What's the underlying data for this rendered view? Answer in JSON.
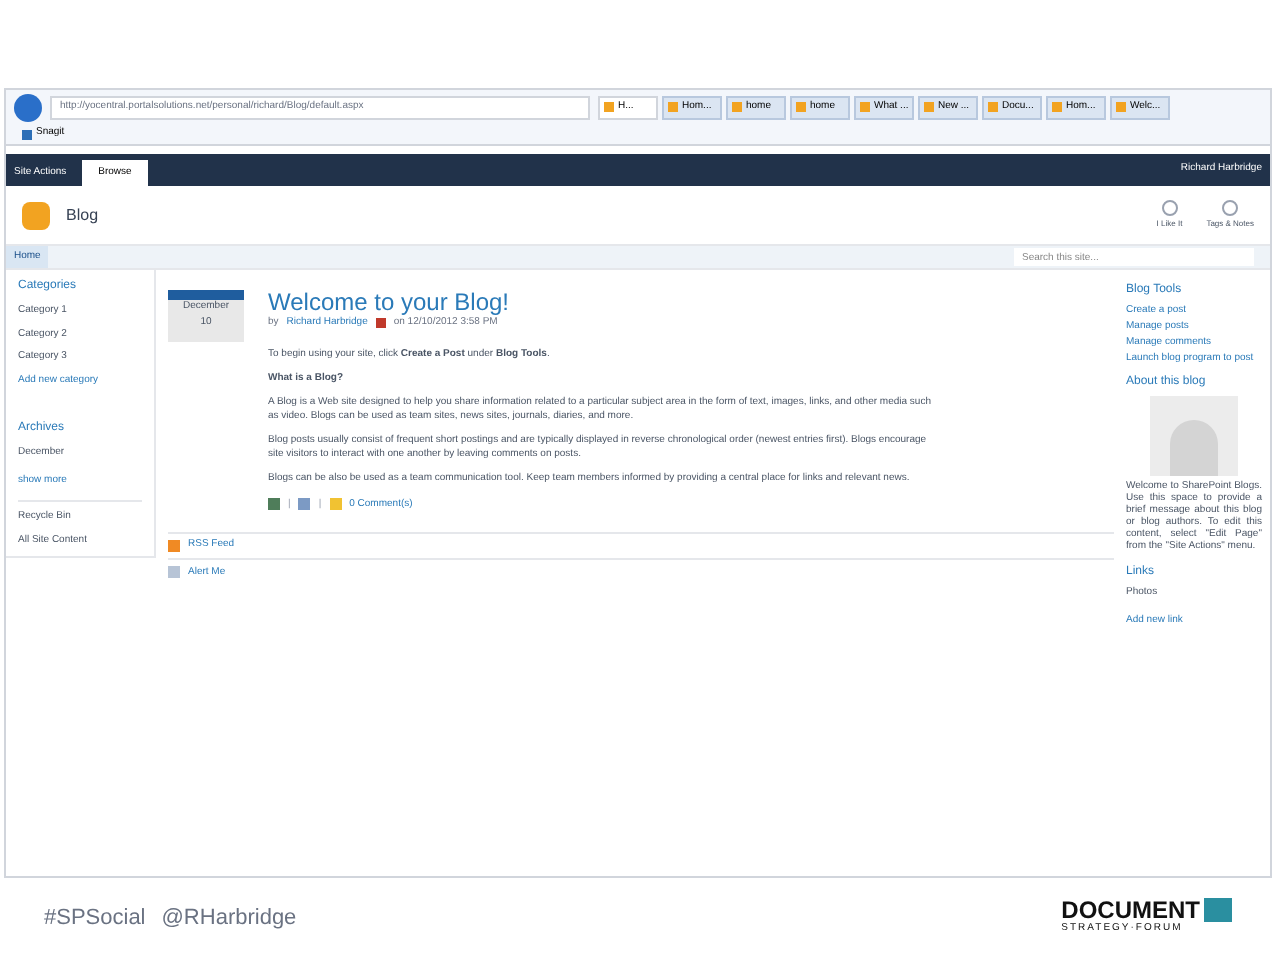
{
  "browser": {
    "url": "http://yocentral.portalsolutions.net/personal/richard/Blog/default.aspx",
    "tabs": [
      {
        "label": "H...",
        "selected": true
      },
      {
        "label": "Hom...",
        "selected": false
      },
      {
        "label": "home",
        "selected": false
      },
      {
        "label": "home",
        "selected": false
      },
      {
        "label": "What ...",
        "selected": false
      },
      {
        "label": "New ...",
        "selected": false
      },
      {
        "label": "Docu...",
        "selected": false
      },
      {
        "label": "Hom...",
        "selected": false
      },
      {
        "label": "Welc...",
        "selected": false
      }
    ],
    "favorites": [
      "Snagit"
    ]
  },
  "ribbon": {
    "site_actions": "Site Actions",
    "tab": "Browse",
    "user": "Richard Harbridge",
    "buttons": [
      "I Like It",
      "Tags & Notes"
    ]
  },
  "site": {
    "title": "Blog",
    "nav": "Home",
    "search_placeholder": "Search this site..."
  },
  "sidebar": {
    "categories_heading": "Categories",
    "categories": [
      "Category 1",
      "Category 2",
      "Category 3"
    ],
    "add_category": "Add new category",
    "archives_heading": "Archives",
    "archives": [
      "December"
    ],
    "show_more": "show more",
    "links": [
      "Recycle Bin",
      "All Site Content"
    ]
  },
  "post": {
    "month": "December",
    "day": "10",
    "title": "Welcome to your Blog!",
    "by": "by",
    "author": "Richard Harbridge",
    "date": "on 12/10/2012 3:58 PM",
    "paragraphs": [
      {
        "text": "To begin using your site, click **Create a Post** under **Blog Tools**.",
        "kind": "text"
      },
      {
        "text": "What is a Blog?",
        "kind": "heading"
      },
      {
        "text": "A Blog is a Web site designed to help you share information related to a particular subject area in the form of text, images, links, and other media such as video. Blogs can be used as team sites, news sites, journals, diaries, and more.",
        "kind": "text"
      },
      {
        "text": "Blog posts usually consist of frequent short postings and are typically displayed in reverse chronological order (newest entries first). Blogs encourage site visitors to interact with one another by leaving comments on posts.",
        "kind": "text"
      },
      {
        "text": "Blogs can be also be used as a team communication tool. Keep team members informed by providing a central place for links and relevant news.",
        "kind": "text"
      }
    ],
    "separators": [
      "|",
      "|"
    ],
    "comments": "0 Comment(s)"
  },
  "feed_links": [
    "RSS Feed",
    "Alert Me"
  ],
  "right": {
    "tools_heading": "Blog Tools",
    "tools": [
      "Create a post",
      "Manage posts",
      "Manage comments",
      "Launch blog program to post"
    ],
    "about_heading": "About this blog",
    "about_text": "Welcome to SharePoint Blogs. Use this space to provide a brief message about this blog or blog authors. To edit this content, select \"Edit Page\" from the \"Site Actions\" menu.",
    "links_heading": "Links",
    "links": [
      "Photos"
    ],
    "add_link": "Add new link"
  },
  "slide_footer": {
    "hashtag": "#SPSocial",
    "handle": "@RHarbridge",
    "logo_word": "DOCUMENT",
    "logo_sub": "STRATEGY·FORUM"
  }
}
